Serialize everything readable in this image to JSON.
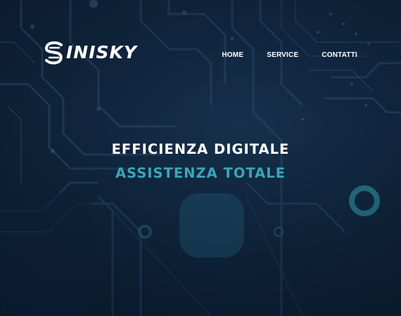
{
  "brand": {
    "name": "INISKY",
    "logo_icon": "s-swirl-logo-icon"
  },
  "nav": {
    "items": [
      {
        "label": "HOME"
      },
      {
        "label": "SERVICE"
      },
      {
        "label": "CONTATTI"
      }
    ]
  },
  "hero": {
    "line1": "EFFICIENZA DIGITALE",
    "line2": "ASSISTENZA TOTALE",
    "background": "circuit-board-image"
  },
  "colors": {
    "background": "#10253d",
    "accent": "#3aa6b9",
    "text": "#ffffff"
  }
}
